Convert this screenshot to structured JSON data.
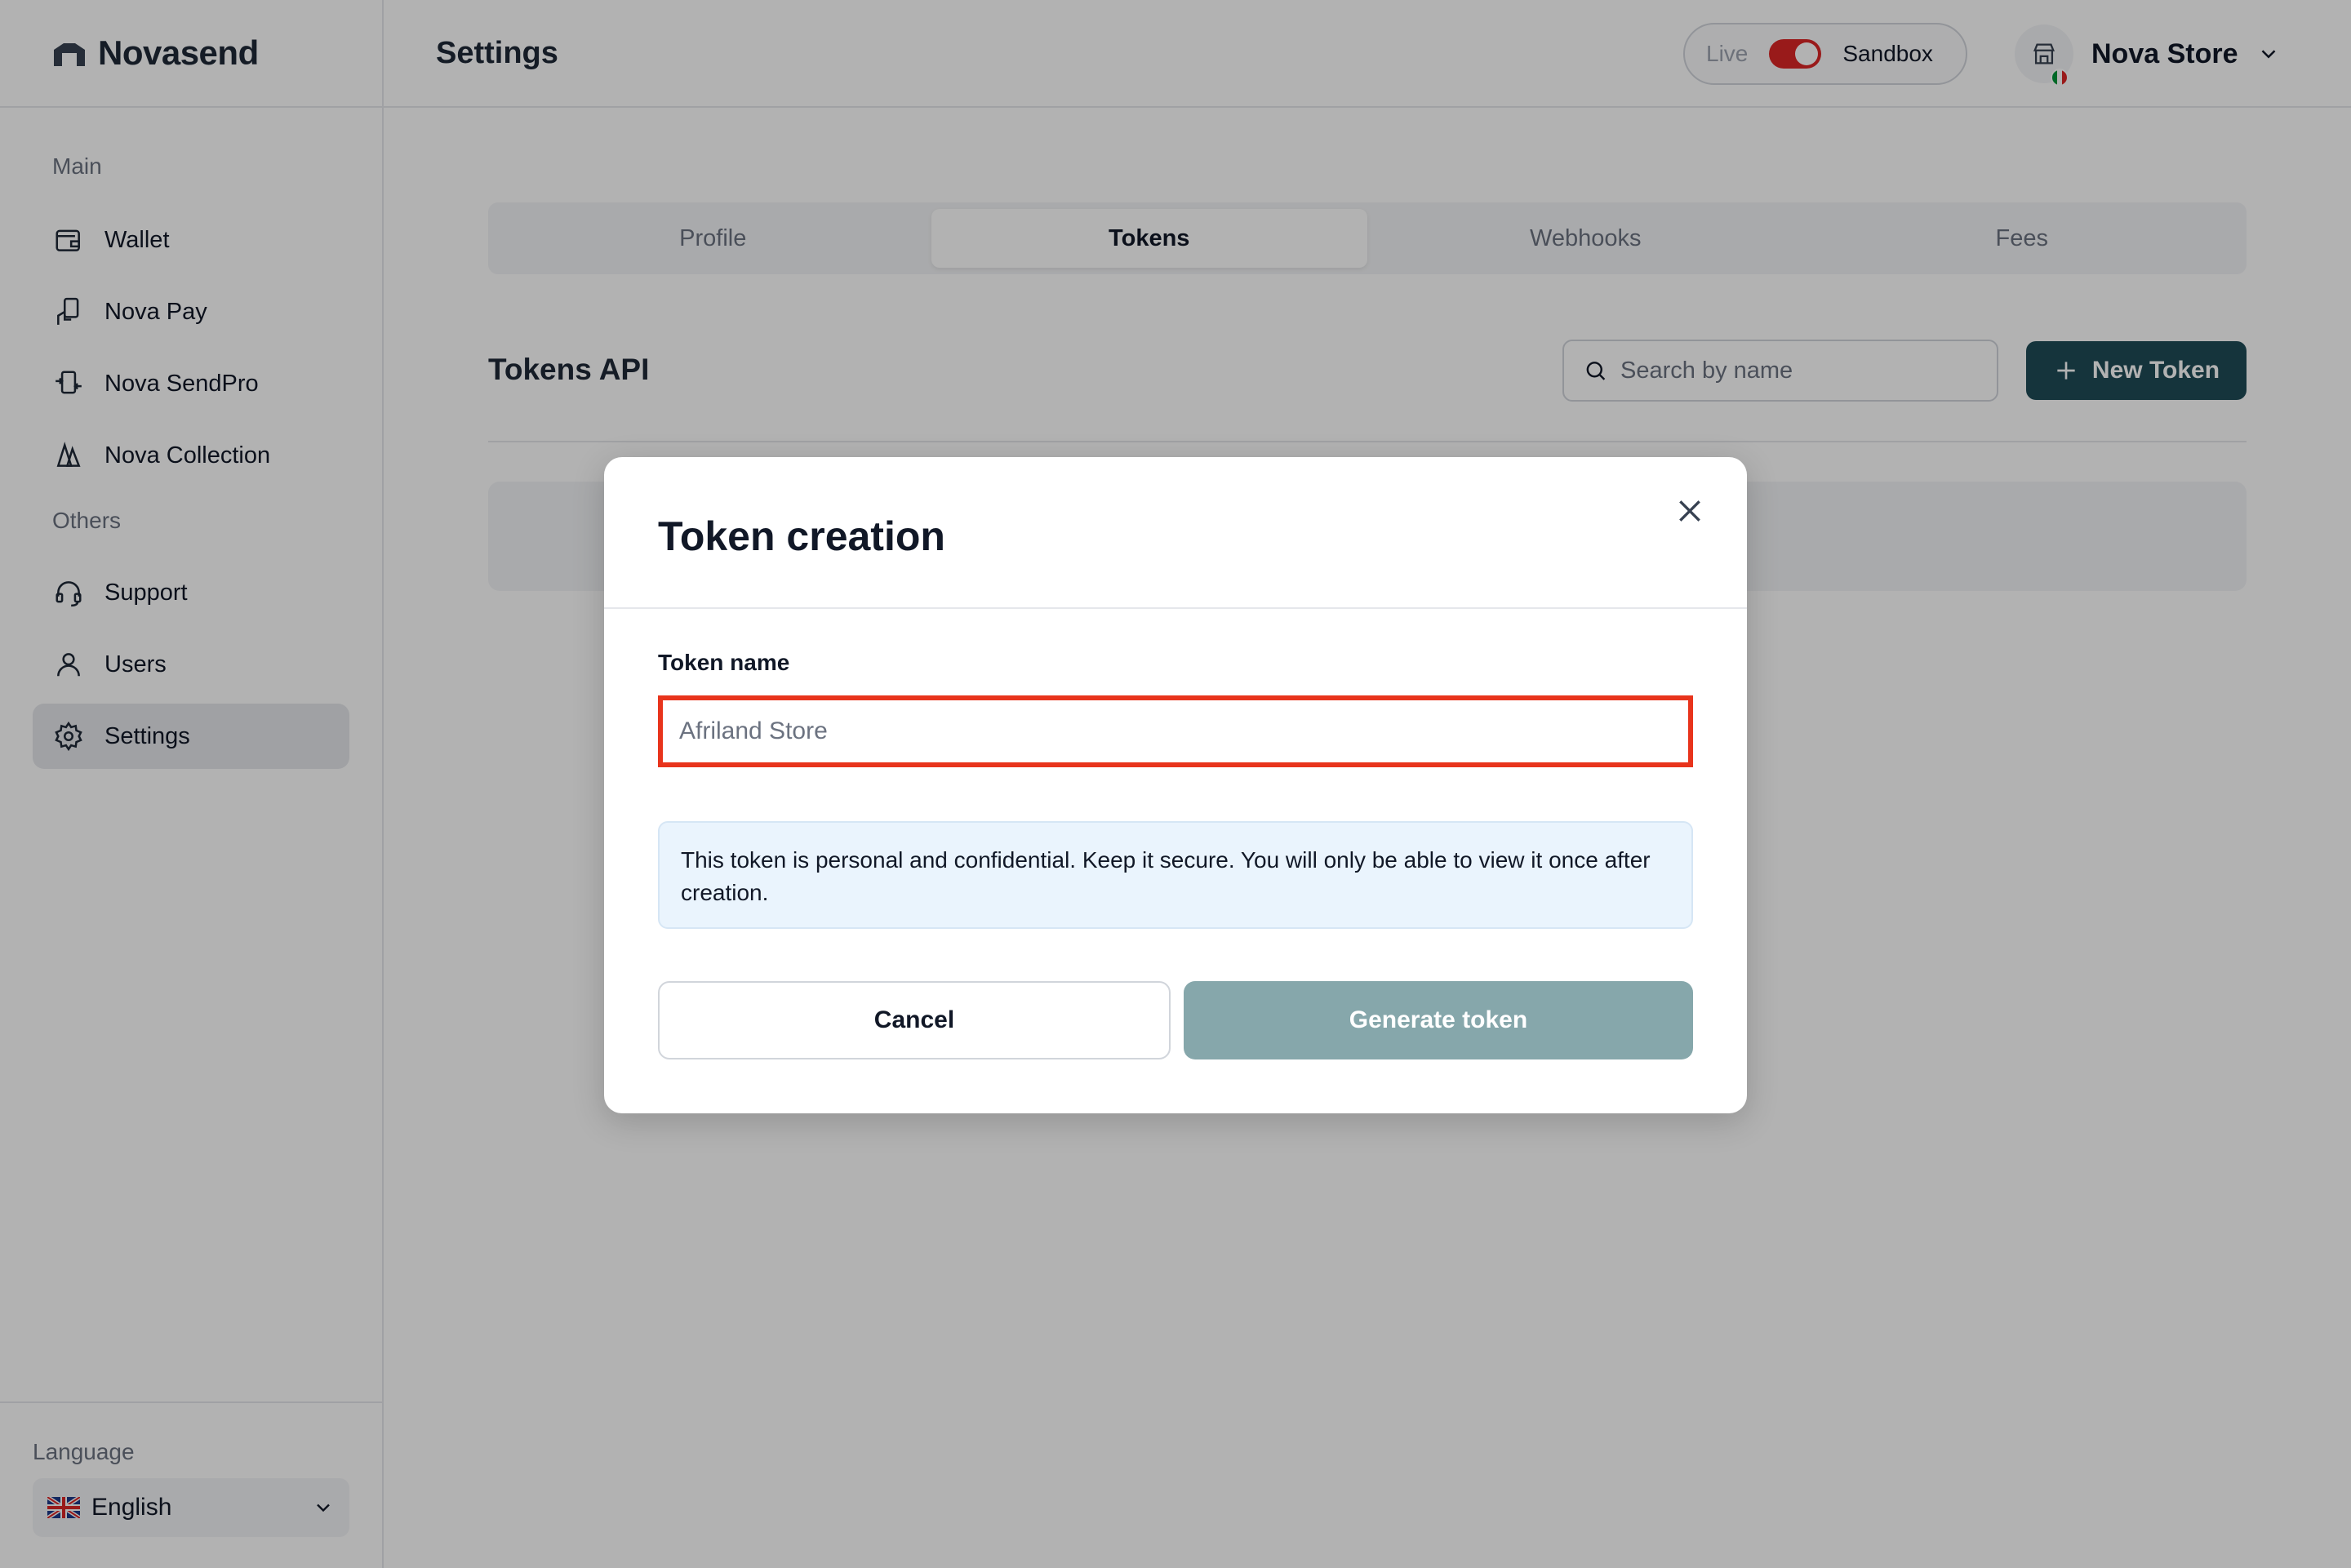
{
  "brand": {
    "name": "Novasend"
  },
  "sidebar": {
    "section_main": "Main",
    "section_others": "Others",
    "items": [
      {
        "label": "Wallet",
        "icon": "wallet-icon"
      },
      {
        "label": "Nova Pay",
        "icon": "hand-phone-icon"
      },
      {
        "label": "Nova SendPro",
        "icon": "transfer-icon"
      },
      {
        "label": "Nova Collection",
        "icon": "collection-icon"
      },
      {
        "label": "Support",
        "icon": "headset-icon"
      },
      {
        "label": "Users",
        "icon": "user-icon"
      },
      {
        "label": "Settings",
        "icon": "gear-icon",
        "active": true
      }
    ],
    "language_label": "Language",
    "language_value": "English"
  },
  "header": {
    "title": "Settings",
    "env_live": "Live",
    "env_sandbox": "Sandbox",
    "env_sandbox_active": true,
    "store_name": "Nova Store"
  },
  "tabs": [
    "Profile",
    "Tokens",
    "Webhooks",
    "Fees"
  ],
  "active_tab": "Tokens",
  "tokens_section": {
    "title": "Tokens API",
    "search_placeholder": "Search by name",
    "new_token_label": "New Token"
  },
  "modal": {
    "title": "Token creation",
    "field_label": "Token name",
    "field_placeholder": "Afriland Store",
    "notice": "This token is personal and confidential. Keep it secure. You will only be able to view it once after creation.",
    "cancel_label": "Cancel",
    "generate_label": "Generate token"
  },
  "colors": {
    "primary": "#1f4b57",
    "generate_disabled": "#86a7ab",
    "highlight_border": "#e8341c",
    "toggle": "#dc2626",
    "notice_bg": "#eaf4fd"
  }
}
